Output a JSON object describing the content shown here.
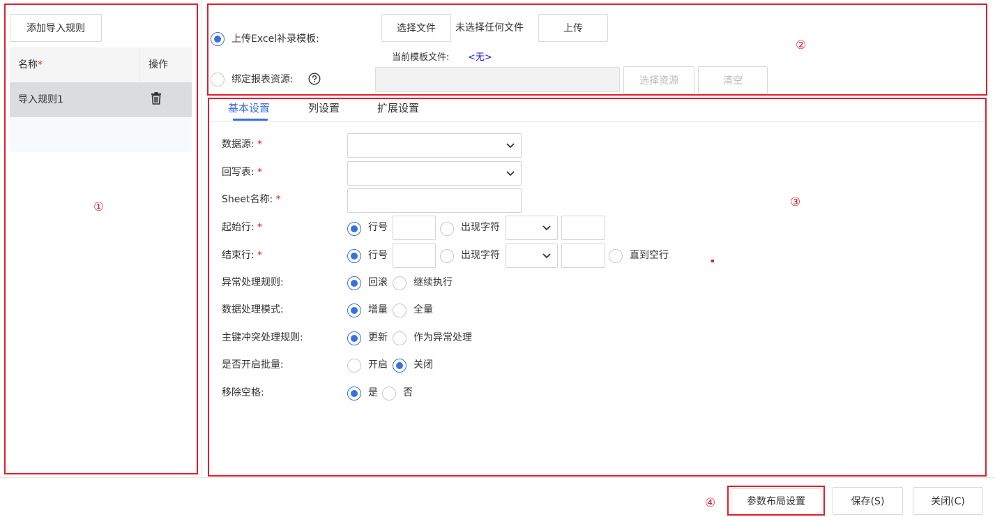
{
  "left_panel": {
    "add_button": "添加导入规则",
    "col_name": "名称",
    "col_name_required": "*",
    "col_action": "操作",
    "rows": [
      {
        "name": "导入规则1"
      }
    ]
  },
  "upload": {
    "upload_excel_label": "上传Excel补录模板:",
    "choose_file_button": "选择文件",
    "no_file_text": "未选择任何文件",
    "upload_button": "上传",
    "current_template_label": "当前模板文件:",
    "current_template_value": "<无>",
    "bind_resource_label": "绑定报表资源:",
    "choose_resource_button": "选择资源",
    "clear_button": "清空"
  },
  "tabs": [
    {
      "label": "基本设置",
      "active": true
    },
    {
      "label": "列设置",
      "active": false
    },
    {
      "label": "扩展设置",
      "active": false
    }
  ],
  "form": {
    "datasource_label": "数据源:",
    "writeback_label": "回写表:",
    "sheet_label": "Sheet名称:",
    "start_row_label": "起始行:",
    "end_row_label": "结束行:",
    "required_mark": "*",
    "row_number_option": "行号",
    "appear_char_option": "出现字符",
    "until_empty_option": "直到空行",
    "exception_label": "异常处理规则:",
    "rollback_option": "回滚",
    "continue_option": "继续执行",
    "mode_label": "数据处理模式:",
    "increment_option": "增量",
    "full_option": "全量",
    "pk_label": "主键冲突处理规则:",
    "update_option": "更新",
    "as_exception_option": "作为异常处理",
    "batch_label": "是否开启批量:",
    "open_option": "开启",
    "close_option": "关闭",
    "trim_label": "移除空格:",
    "yes_option": "是",
    "no_option": "否"
  },
  "footer": {
    "layout_button": "参数布局设置",
    "save_button": "保存(S)",
    "close_button": "关闭(C)"
  },
  "annotations": {
    "one": "①",
    "two": "②",
    "three": "③",
    "four": "④"
  },
  "colors": {
    "accent": "#3b6fe0",
    "annotation_red": "#e0202a"
  },
  "icons": {
    "delete": "trash-icon",
    "help": "question-circle-icon",
    "dropdown": "chevron-down-icon"
  }
}
